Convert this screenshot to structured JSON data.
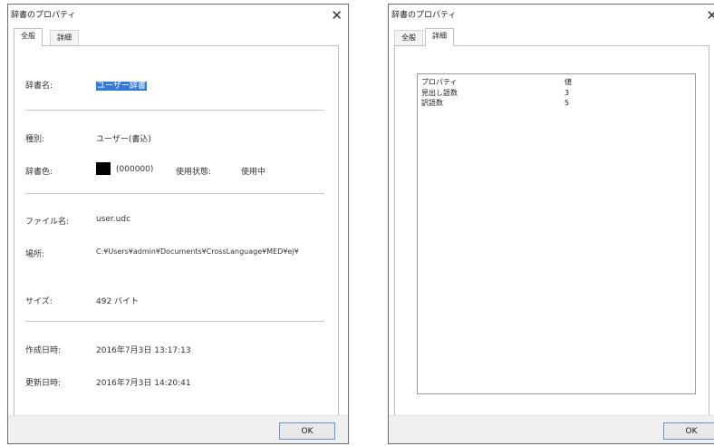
{
  "dialog_left": {
    "title": "辞書のプロパティ",
    "close_glyph": "✕",
    "tabs": [
      {
        "label": "全般"
      },
      {
        "label": "詳細"
      }
    ],
    "fields": {
      "name_label": "辞書名:",
      "name_value": "ユーザー辞書",
      "type_label": "種別:",
      "type_value": "ユーザー(書込)",
      "color_label": "辞書色:",
      "color_value": "(000000)",
      "color_hex": "#000000",
      "usage_label": "使用状態:",
      "usage_value": "使用中",
      "filename_label": "ファイル名:",
      "filename_value": "user.udc",
      "location_label": "場所:",
      "location_value": "C:¥Users¥admin¥Documents¥CrossLanguage¥MED¥ej¥",
      "size_label": "サイズ:",
      "size_value": "492 バイト",
      "created_label": "作成日時:",
      "created_value": "2016年7月3日 13:17:13",
      "updated_label": "更新日時:",
      "updated_value": "2016年7月3日 14:20:41"
    },
    "ok_label": "OK"
  },
  "dialog_right": {
    "title": "辞書のプロパティ",
    "close_glyph": "✕",
    "tabs": [
      {
        "label": "全般"
      },
      {
        "label": "詳細"
      }
    ],
    "list": {
      "headers": {
        "property": "プロパティ",
        "value": "値"
      },
      "rows": [
        {
          "property": "見出し語数",
          "value": "3"
        },
        {
          "property": "訳語数",
          "value": "5"
        }
      ]
    },
    "ok_label": "OK"
  },
  "colors": {
    "selection": "#3478d8",
    "ok_border": "#6b8fc7"
  }
}
